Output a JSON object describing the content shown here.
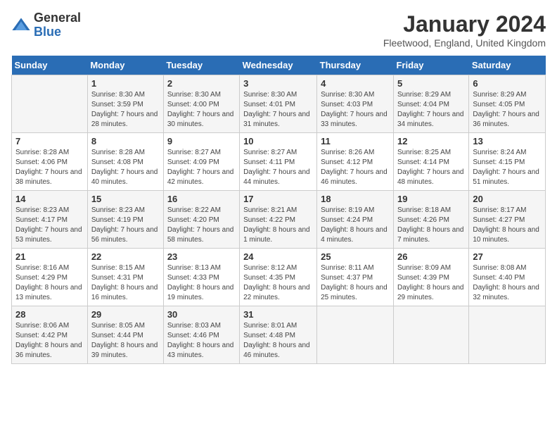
{
  "logo": {
    "general": "General",
    "blue": "Blue"
  },
  "header": {
    "title": "January 2024",
    "subtitle": "Fleetwood, England, United Kingdom"
  },
  "days_of_week": [
    "Sunday",
    "Monday",
    "Tuesday",
    "Wednesday",
    "Thursday",
    "Friday",
    "Saturday"
  ],
  "weeks": [
    [
      {
        "day": "",
        "sunrise": "",
        "sunset": "",
        "daylight": ""
      },
      {
        "day": "1",
        "sunrise": "Sunrise: 8:30 AM",
        "sunset": "Sunset: 3:59 PM",
        "daylight": "Daylight: 7 hours and 28 minutes."
      },
      {
        "day": "2",
        "sunrise": "Sunrise: 8:30 AM",
        "sunset": "Sunset: 4:00 PM",
        "daylight": "Daylight: 7 hours and 30 minutes."
      },
      {
        "day": "3",
        "sunrise": "Sunrise: 8:30 AM",
        "sunset": "Sunset: 4:01 PM",
        "daylight": "Daylight: 7 hours and 31 minutes."
      },
      {
        "day": "4",
        "sunrise": "Sunrise: 8:30 AM",
        "sunset": "Sunset: 4:03 PM",
        "daylight": "Daylight: 7 hours and 33 minutes."
      },
      {
        "day": "5",
        "sunrise": "Sunrise: 8:29 AM",
        "sunset": "Sunset: 4:04 PM",
        "daylight": "Daylight: 7 hours and 34 minutes."
      },
      {
        "day": "6",
        "sunrise": "Sunrise: 8:29 AM",
        "sunset": "Sunset: 4:05 PM",
        "daylight": "Daylight: 7 hours and 36 minutes."
      }
    ],
    [
      {
        "day": "7",
        "sunrise": "Sunrise: 8:28 AM",
        "sunset": "Sunset: 4:06 PM",
        "daylight": "Daylight: 7 hours and 38 minutes."
      },
      {
        "day": "8",
        "sunrise": "Sunrise: 8:28 AM",
        "sunset": "Sunset: 4:08 PM",
        "daylight": "Daylight: 7 hours and 40 minutes."
      },
      {
        "day": "9",
        "sunrise": "Sunrise: 8:27 AM",
        "sunset": "Sunset: 4:09 PM",
        "daylight": "Daylight: 7 hours and 42 minutes."
      },
      {
        "day": "10",
        "sunrise": "Sunrise: 8:27 AM",
        "sunset": "Sunset: 4:11 PM",
        "daylight": "Daylight: 7 hours and 44 minutes."
      },
      {
        "day": "11",
        "sunrise": "Sunrise: 8:26 AM",
        "sunset": "Sunset: 4:12 PM",
        "daylight": "Daylight: 7 hours and 46 minutes."
      },
      {
        "day": "12",
        "sunrise": "Sunrise: 8:25 AM",
        "sunset": "Sunset: 4:14 PM",
        "daylight": "Daylight: 7 hours and 48 minutes."
      },
      {
        "day": "13",
        "sunrise": "Sunrise: 8:24 AM",
        "sunset": "Sunset: 4:15 PM",
        "daylight": "Daylight: 7 hours and 51 minutes."
      }
    ],
    [
      {
        "day": "14",
        "sunrise": "Sunrise: 8:23 AM",
        "sunset": "Sunset: 4:17 PM",
        "daylight": "Daylight: 7 hours and 53 minutes."
      },
      {
        "day": "15",
        "sunrise": "Sunrise: 8:23 AM",
        "sunset": "Sunset: 4:19 PM",
        "daylight": "Daylight: 7 hours and 56 minutes."
      },
      {
        "day": "16",
        "sunrise": "Sunrise: 8:22 AM",
        "sunset": "Sunset: 4:20 PM",
        "daylight": "Daylight: 7 hours and 58 minutes."
      },
      {
        "day": "17",
        "sunrise": "Sunrise: 8:21 AM",
        "sunset": "Sunset: 4:22 PM",
        "daylight": "Daylight: 8 hours and 1 minute."
      },
      {
        "day": "18",
        "sunrise": "Sunrise: 8:19 AM",
        "sunset": "Sunset: 4:24 PM",
        "daylight": "Daylight: 8 hours and 4 minutes."
      },
      {
        "day": "19",
        "sunrise": "Sunrise: 8:18 AM",
        "sunset": "Sunset: 4:26 PM",
        "daylight": "Daylight: 8 hours and 7 minutes."
      },
      {
        "day": "20",
        "sunrise": "Sunrise: 8:17 AM",
        "sunset": "Sunset: 4:27 PM",
        "daylight": "Daylight: 8 hours and 10 minutes."
      }
    ],
    [
      {
        "day": "21",
        "sunrise": "Sunrise: 8:16 AM",
        "sunset": "Sunset: 4:29 PM",
        "daylight": "Daylight: 8 hours and 13 minutes."
      },
      {
        "day": "22",
        "sunrise": "Sunrise: 8:15 AM",
        "sunset": "Sunset: 4:31 PM",
        "daylight": "Daylight: 8 hours and 16 minutes."
      },
      {
        "day": "23",
        "sunrise": "Sunrise: 8:13 AM",
        "sunset": "Sunset: 4:33 PM",
        "daylight": "Daylight: 8 hours and 19 minutes."
      },
      {
        "day": "24",
        "sunrise": "Sunrise: 8:12 AM",
        "sunset": "Sunset: 4:35 PM",
        "daylight": "Daylight: 8 hours and 22 minutes."
      },
      {
        "day": "25",
        "sunrise": "Sunrise: 8:11 AM",
        "sunset": "Sunset: 4:37 PM",
        "daylight": "Daylight: 8 hours and 25 minutes."
      },
      {
        "day": "26",
        "sunrise": "Sunrise: 8:09 AM",
        "sunset": "Sunset: 4:39 PM",
        "daylight": "Daylight: 8 hours and 29 minutes."
      },
      {
        "day": "27",
        "sunrise": "Sunrise: 8:08 AM",
        "sunset": "Sunset: 4:40 PM",
        "daylight": "Daylight: 8 hours and 32 minutes."
      }
    ],
    [
      {
        "day": "28",
        "sunrise": "Sunrise: 8:06 AM",
        "sunset": "Sunset: 4:42 PM",
        "daylight": "Daylight: 8 hours and 36 minutes."
      },
      {
        "day": "29",
        "sunrise": "Sunrise: 8:05 AM",
        "sunset": "Sunset: 4:44 PM",
        "daylight": "Daylight: 8 hours and 39 minutes."
      },
      {
        "day": "30",
        "sunrise": "Sunrise: 8:03 AM",
        "sunset": "Sunset: 4:46 PM",
        "daylight": "Daylight: 8 hours and 43 minutes."
      },
      {
        "day": "31",
        "sunrise": "Sunrise: 8:01 AM",
        "sunset": "Sunset: 4:48 PM",
        "daylight": "Daylight: 8 hours and 46 minutes."
      },
      {
        "day": "",
        "sunrise": "",
        "sunset": "",
        "daylight": ""
      },
      {
        "day": "",
        "sunrise": "",
        "sunset": "",
        "daylight": ""
      },
      {
        "day": "",
        "sunrise": "",
        "sunset": "",
        "daylight": ""
      }
    ]
  ]
}
